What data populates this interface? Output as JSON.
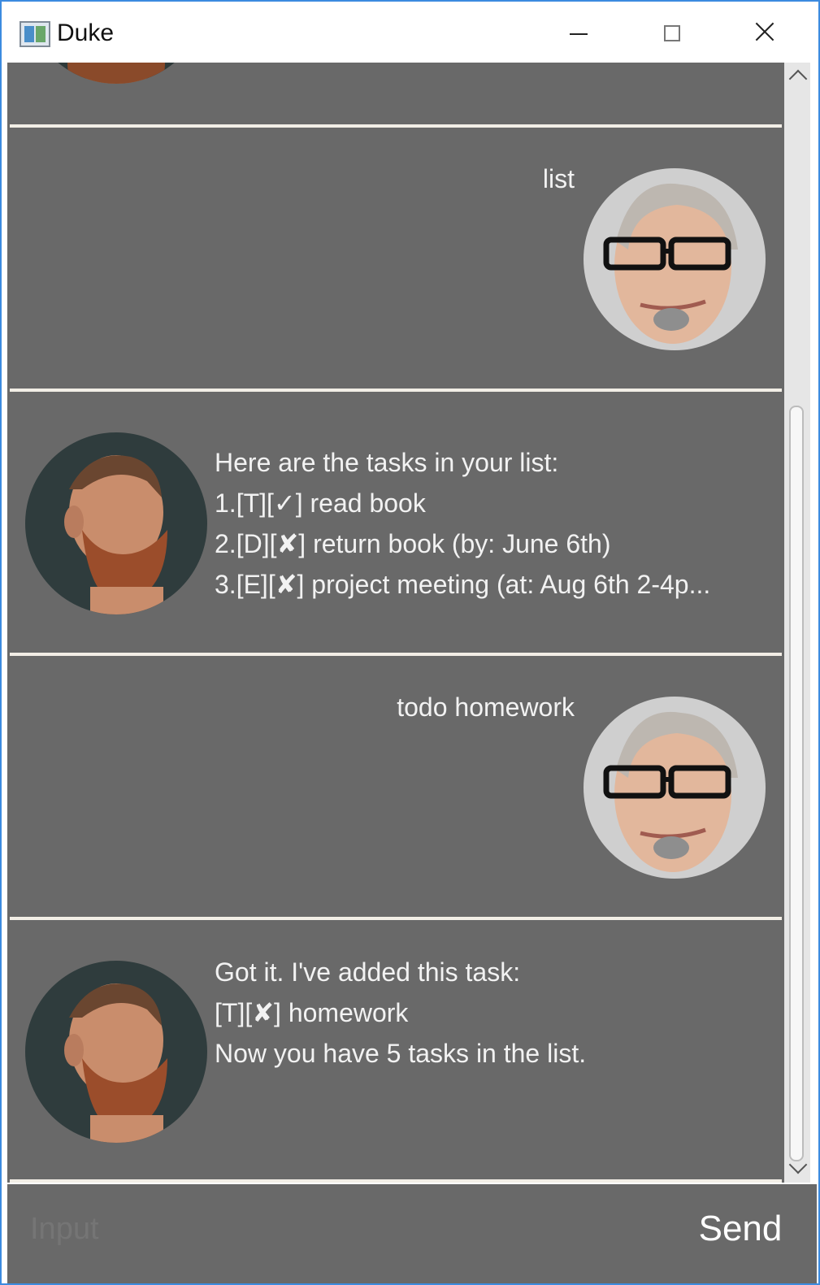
{
  "window": {
    "title": "Duke"
  },
  "messages": {
    "m1": {
      "sender": "user",
      "text": "list"
    },
    "m2": {
      "sender": "duke",
      "lines": [
        "Here are the tasks in your list:",
        "1.[T][✓] read book",
        "2.[D][✘] return book (by: June 6th)",
        "3.[E][✘] project meeting (at: Aug 6th 2-4p..."
      ]
    },
    "m3": {
      "sender": "user",
      "text": "todo homework"
    },
    "m4": {
      "sender": "duke",
      "lines": [
        "Got it. I've added this task:",
        "[T][✘] homework",
        "Now you have 5 tasks in the list."
      ]
    }
  },
  "input": {
    "placeholder": "Input",
    "value": ""
  },
  "send_label": "Send",
  "colors": {
    "chat_bg": "#696969",
    "divider": "#f2eee6",
    "text": "#f2f2f2",
    "window_border": "#3c8be0"
  }
}
